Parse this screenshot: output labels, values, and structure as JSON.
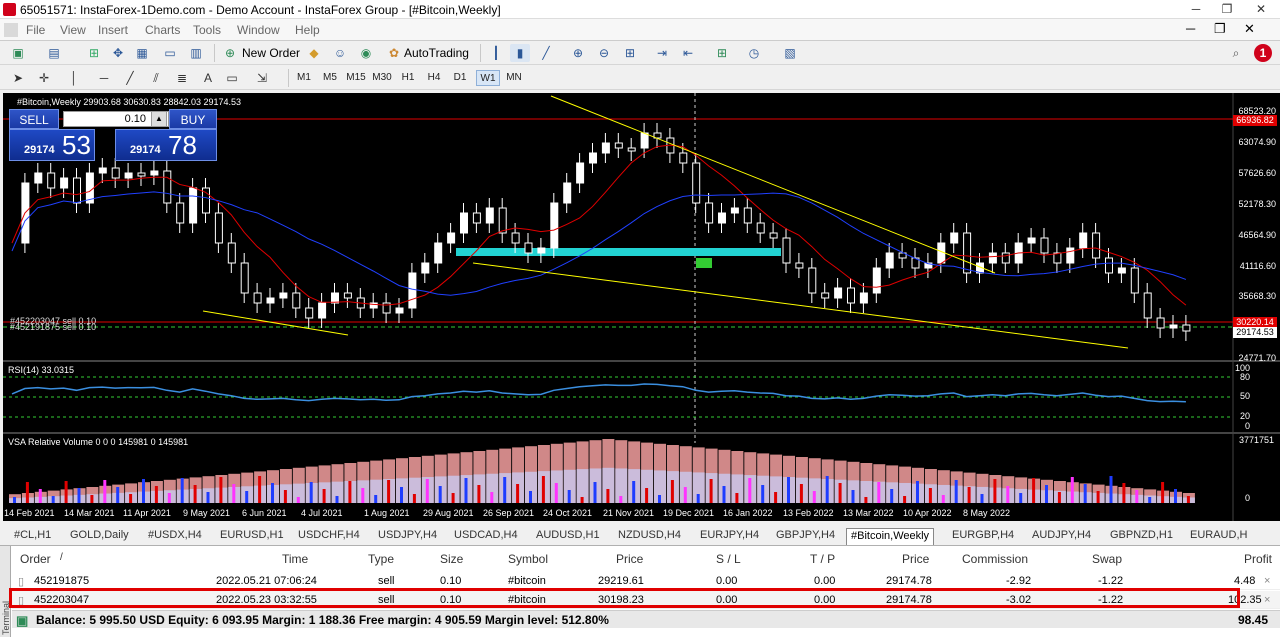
{
  "window": {
    "title": "65051571: InstaForex-1Demo.com - Demo Account - InstaForex Group - [#Bitcoin,Weekly]",
    "min": "─",
    "restore": "❐",
    "close": "✕",
    "inner_min": "─",
    "inner_restore": "❐",
    "inner_close": "✕"
  },
  "menu": {
    "items": [
      "File",
      "View",
      "Insert",
      "Charts",
      "Tools",
      "Window",
      "Help"
    ],
    "notification_count": "1"
  },
  "toolbar": {
    "new_order": "New Order",
    "autotrading": "AutoTrading"
  },
  "timeframes": [
    "M1",
    "M5",
    "M15",
    "M30",
    "H1",
    "H4",
    "D1",
    "W1",
    "MN"
  ],
  "active_timeframe": "W1",
  "chart": {
    "header": "#Bitcoin,Weekly  29903.68 30630.83 28842.03 29174.53",
    "one_click": {
      "sell": "SELL",
      "buy": "BUY",
      "lot": "0.10",
      "sell_small": "29174",
      "sell_big": "53",
      "buy_small": "29174",
      "buy_big": "78"
    },
    "order_labels": [
      "#452203047 sell 0.10",
      "#452191875 sell 0.10"
    ],
    "price_axis": [
      "68523.20",
      "63074.90",
      "57626.60",
      "52178.30",
      "46564.90",
      "41116.60",
      "35668.30",
      "30220.00",
      "24771.70"
    ],
    "price_tags": {
      "hline": "66936.82",
      "order": "30220.14",
      "bid": "29174.53"
    },
    "rsi_label": "RSI(14) 33.0315",
    "rsi_axis": [
      "100",
      "80",
      "50",
      "20",
      "0"
    ],
    "vsa_label": "VSA Relative Volume 0 0 0 145981 0 145981",
    "vsa_axis": [
      "3771751",
      "0"
    ],
    "dates": [
      "14 Feb 2021",
      "14 Mar 2021",
      "11 Apr 2021",
      "9 May 2021",
      "6 Jun 2021",
      "4 Jul 2021",
      "1 Aug 2021",
      "29 Aug 2021",
      "26 Sep 2021",
      "24 Oct 2021",
      "21 Nov 2021",
      "19 Dec 2021",
      "16 Jan 2022",
      "13 Feb 2022",
      "13 Mar 2022",
      "10 Apr 2022",
      "8 May 2022"
    ],
    "colors": {
      "bg": "#000000",
      "candle_up": "#ffffff",
      "candle_down": "#ffffff",
      "ma_fast": "#e00000",
      "ma_slow": "#2040ff",
      "trend": "#ffff00",
      "zone": "#22d3d3",
      "rsi": "#3b8fe0"
    }
  },
  "symbol_tabs": [
    "#CL,H1",
    "GOLD,Daily",
    "#USDX,H4",
    "EURUSD,H1",
    "USDCHF,H4",
    "USDJPY,H4",
    "USDCAD,H4",
    "AUDUSD,H1",
    "NZDUSD,H4",
    "EURJPY,H4",
    "GBPJPY,H4",
    "#Bitcoin,Weekly",
    "EURGBP,H4",
    "AUDJPY,H4",
    "GBPNZD,H1",
    "EURAUD,H"
  ],
  "active_symbol_tab": "#Bitcoin,Weekly",
  "terminal": {
    "side_label": "Terminal",
    "columns": [
      "Order",
      "/",
      "Time",
      "Type",
      "Size",
      "Symbol",
      "Price",
      "S / L",
      "T / P",
      "Price",
      "Commission",
      "Swap",
      "Profit"
    ],
    "rows": [
      {
        "order": "452191875",
        "time": "2022.05.21 07:06:24",
        "type": "sell",
        "size": "0.10",
        "symbol": "#bitcoin",
        "price": "29219.61",
        "sl": "0.00",
        "tp": "0.00",
        "cur_price": "29174.78",
        "commission": "-2.92",
        "swap": "-1.22",
        "profit": "4.48"
      },
      {
        "order": "452203047",
        "time": "2022.05.23 03:32:55",
        "type": "sell",
        "size": "0.10",
        "symbol": "#bitcoin",
        "price": "30198.23",
        "sl": "0.00",
        "tp": "0.00",
        "cur_price": "29174.78",
        "commission": "-3.02",
        "swap": "-1.22",
        "profit": "102.35"
      }
    ],
    "balance_line": "Balance: 5 995.50 USD  Equity: 6 093.95  Margin: 1 188.36  Free margin: 4 905.59  Margin level: 512.80%",
    "total_profit": "98.45"
  }
}
